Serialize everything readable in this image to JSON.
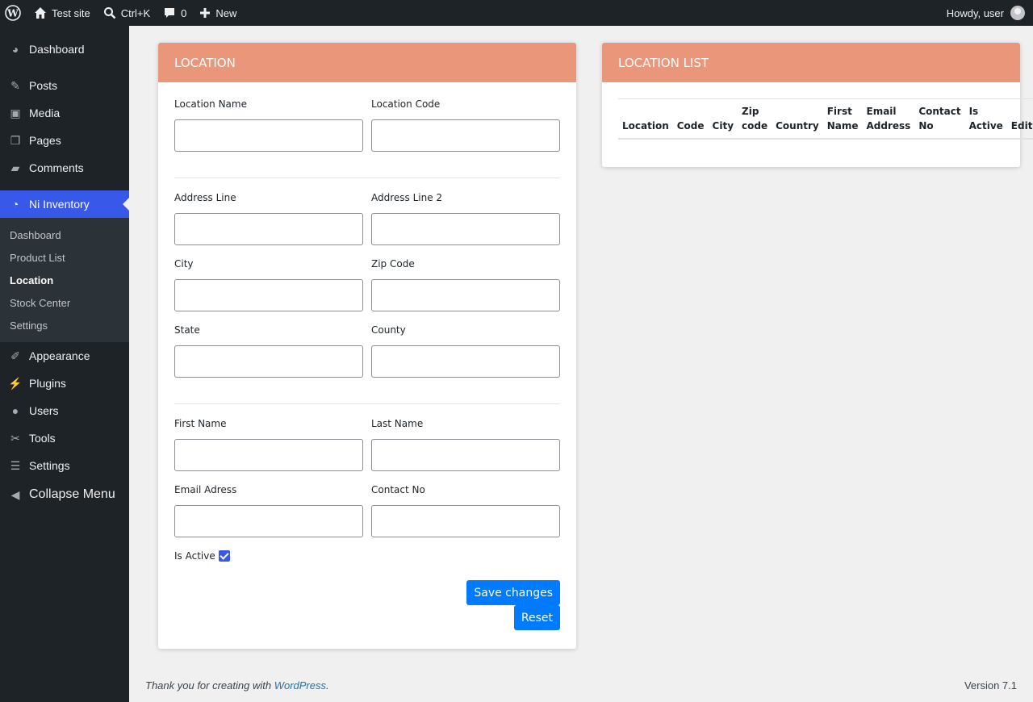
{
  "adminbar": {
    "site_name": "Test site",
    "search_shortcut": "Ctrl+K",
    "comments_count": "0",
    "new_label": "New",
    "greeting": "Howdy, user"
  },
  "sidebar": {
    "items": [
      {
        "label": "Dashboard",
        "icon": "dashboard-icon"
      },
      {
        "label": "Posts",
        "icon": "pin-icon"
      },
      {
        "label": "Media",
        "icon": "media-icon"
      },
      {
        "label": "Pages",
        "icon": "pages-icon"
      },
      {
        "label": "Comments",
        "icon": "comment-icon"
      },
      {
        "label": "Ni Inventory",
        "icon": "chart-pie-icon"
      },
      {
        "label": "Appearance",
        "icon": "brush-icon"
      },
      {
        "label": "Plugins",
        "icon": "plug-icon"
      },
      {
        "label": "Users",
        "icon": "user-icon"
      },
      {
        "label": "Tools",
        "icon": "wrench-icon"
      },
      {
        "label": "Settings",
        "icon": "settings-icon"
      },
      {
        "label": "Collapse Menu",
        "icon": "collapse-icon"
      }
    ],
    "submenu": [
      "Dashboard",
      "Product List",
      "Location",
      "Stock Center",
      "Settings"
    ]
  },
  "location_form": {
    "title": "LOCATION",
    "fields": {
      "location_name": "Location Name",
      "location_code": "Location Code",
      "address_line": "Address Line",
      "address_line_2": "Address Line 2",
      "city": "City",
      "zip_code": "Zip Code",
      "state": "State",
      "county": "County",
      "first_name": "First Name",
      "last_name": "Last Name",
      "email": "Email Adress",
      "contact_no": "Contact No"
    },
    "is_active_label": "Is Active",
    "is_active": true,
    "save_label": "Save changes",
    "reset_label": "Reset"
  },
  "location_list": {
    "title": "LOCATION LIST",
    "columns": [
      "Location",
      "Code",
      "City",
      "Zip code",
      "Country",
      "First Name",
      "Email Address",
      "Contact No",
      "Is Active",
      "Edit"
    ]
  },
  "footer": {
    "thanks_prefix": "Thank you for creating with ",
    "link": "WordPress",
    "suffix": ".",
    "version": "Version 7.1"
  },
  "colors": {
    "accent": "#3858e9",
    "card_header": "#e9967a",
    "button": "#007bff"
  }
}
